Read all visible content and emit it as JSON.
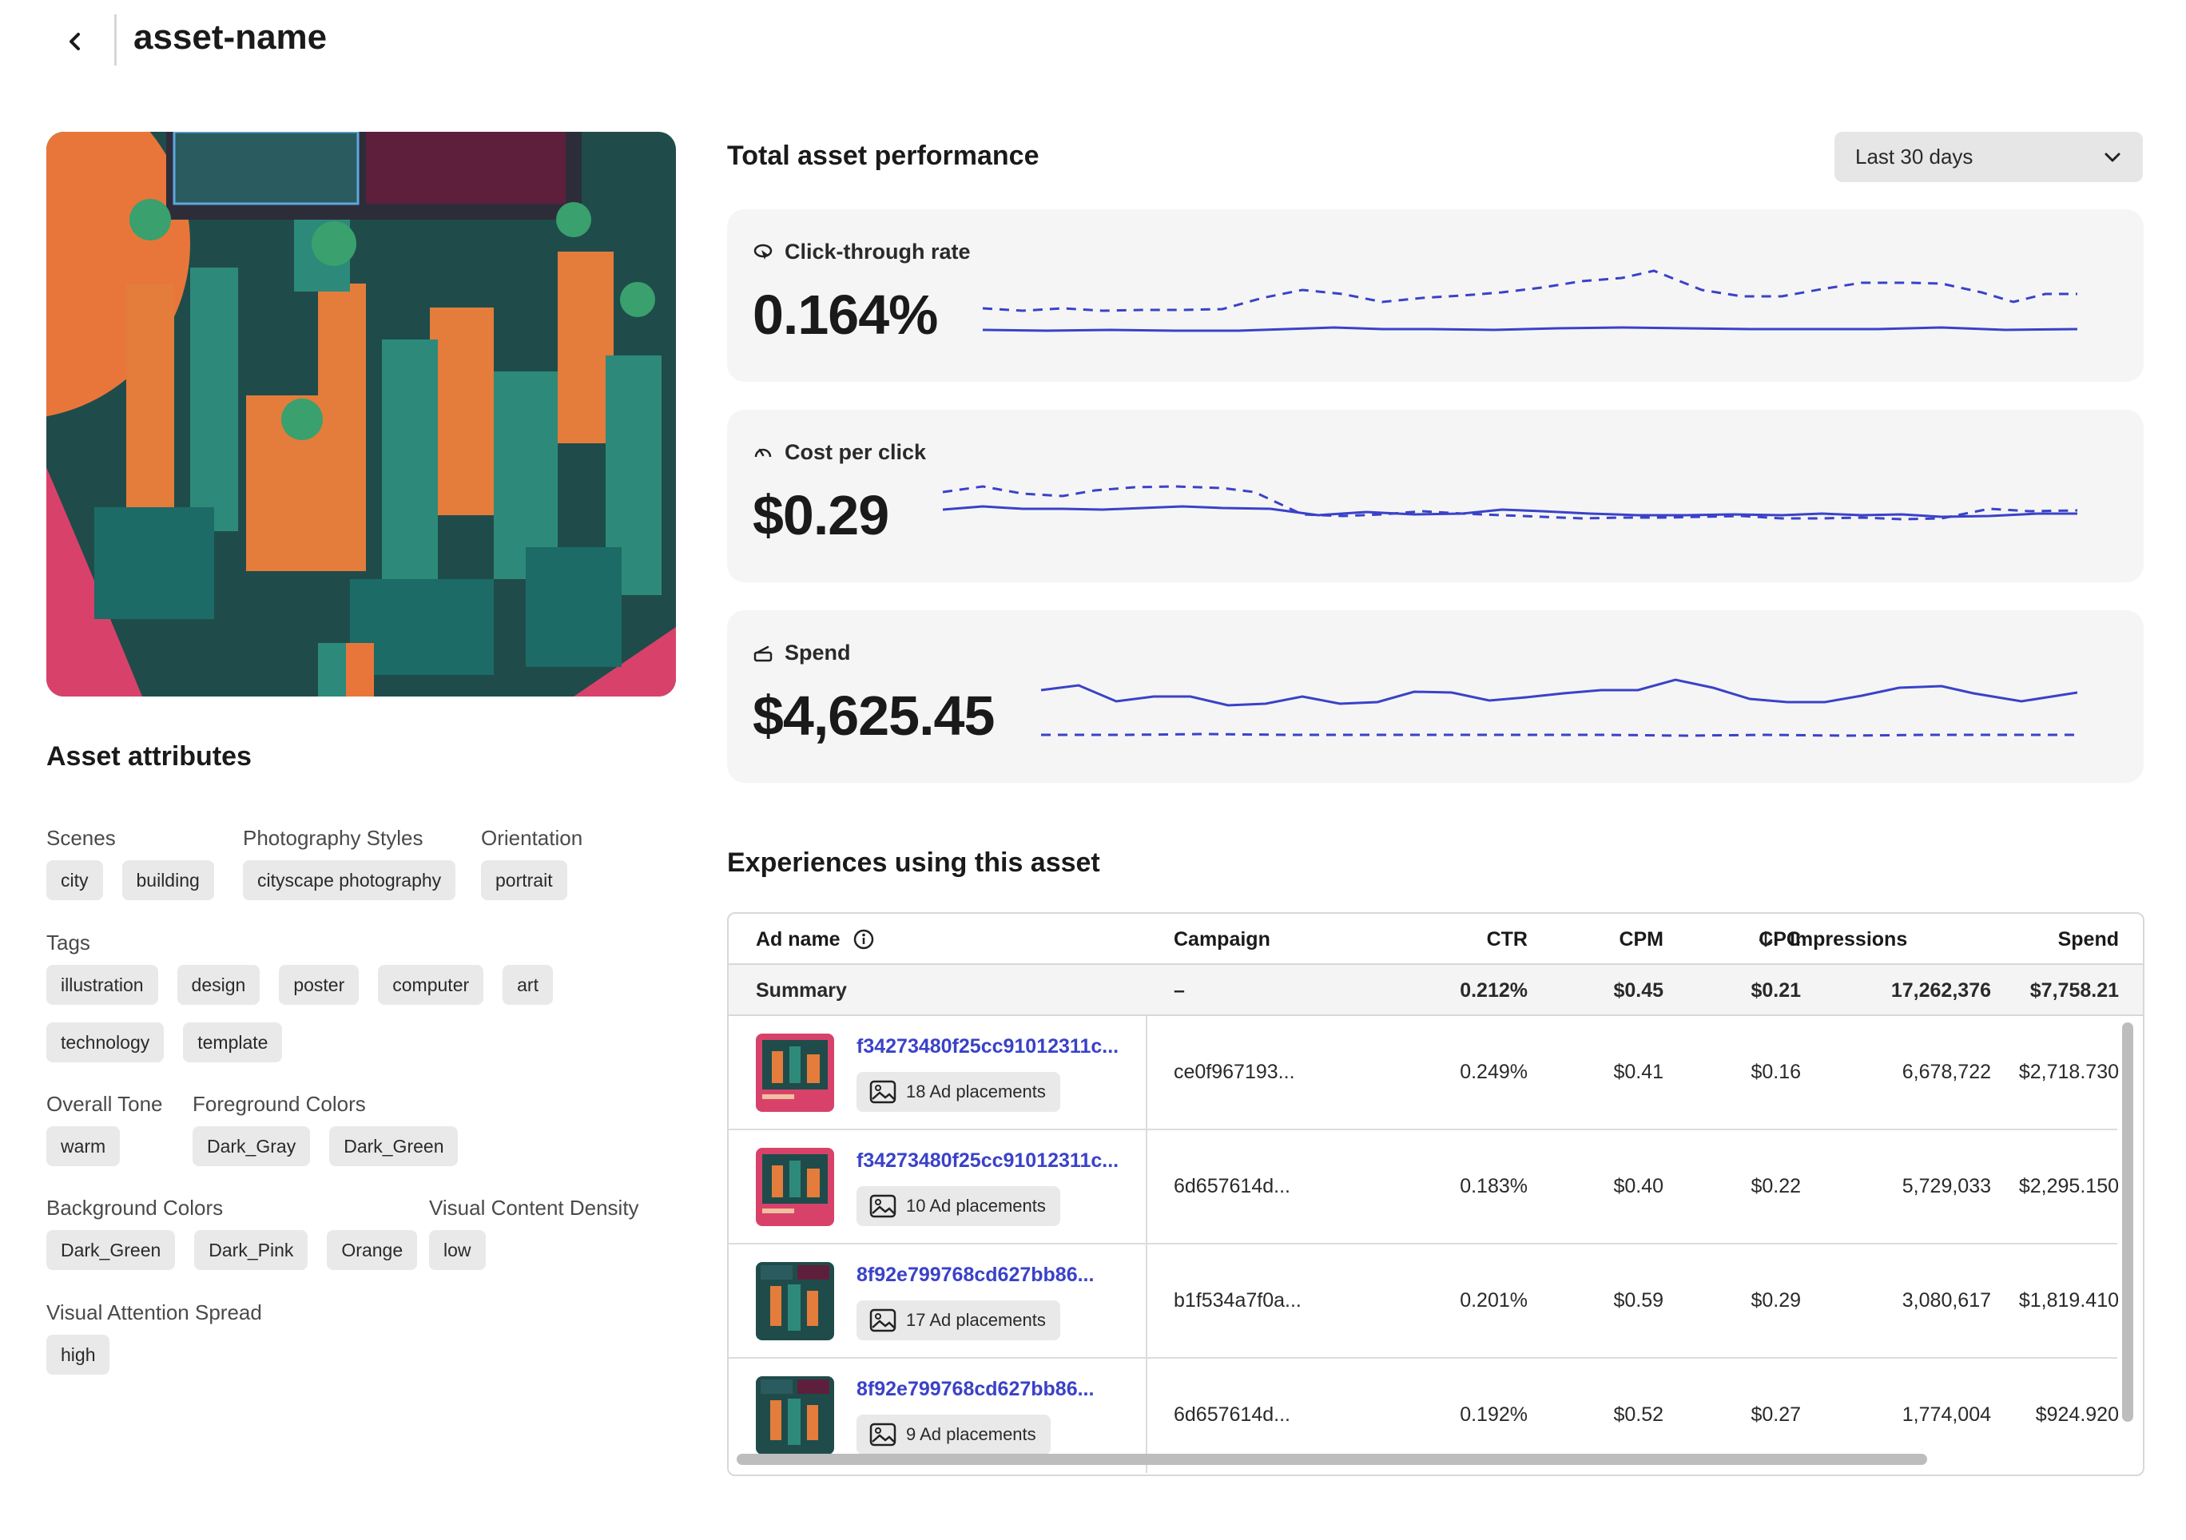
{
  "header": {
    "title": "asset-name"
  },
  "attributes": {
    "title": "Asset attributes",
    "scenes": {
      "label": "Scenes",
      "tags": [
        "city",
        "building"
      ]
    },
    "photography_styles": {
      "label": "Photography Styles",
      "tags": [
        "cityscape photography"
      ]
    },
    "orientation": {
      "label": "Orientation",
      "tags": [
        "portrait"
      ]
    },
    "tags": {
      "label": "Tags",
      "tags": [
        "illustration",
        "design",
        "poster",
        "computer",
        "art",
        "technology",
        "template"
      ]
    },
    "overall_tone": {
      "label": "Overall Tone",
      "tags": [
        "warm"
      ]
    },
    "foreground_colors": {
      "label": "Foreground Colors",
      "tags": [
        "Dark_Gray",
        "Dark_Green"
      ]
    },
    "background_colors": {
      "label": "Background Colors",
      "tags": [
        "Dark_Green",
        "Dark_Pink",
        "Orange"
      ]
    },
    "visual_content_density": {
      "label": "Visual Content Density",
      "tags": [
        "low"
      ]
    },
    "visual_attention_spread": {
      "label": "Visual Attention Spread",
      "tags": [
        "high"
      ]
    }
  },
  "performance": {
    "title": "Total asset performance",
    "range": "Last 30 days",
    "metrics": [
      {
        "label": "Click-through rate",
        "icon": "cursor-click-icon",
        "value": "0.164%"
      },
      {
        "label": "Cost per click",
        "icon": "speedometer-icon",
        "value": "$0.29"
      },
      {
        "label": "Spend",
        "icon": "wallet-icon",
        "value": "$4,625.45"
      }
    ]
  },
  "experiences": {
    "title": "Experiences using this asset",
    "columns": {
      "ad_name": "Ad name",
      "campaign": "Campaign",
      "ctr": "CTR",
      "cpm": "CPM",
      "cpc": "CPC",
      "impressions": "Impressions",
      "spend": "Spend"
    },
    "sorted_column": "Impressions",
    "summary": {
      "label": "Summary",
      "campaign": "–",
      "ctr": "0.212%",
      "cpm": "$0.45",
      "cpc": "$0.21",
      "impressions": "17,262,376",
      "spend": "$7,758.21"
    },
    "rows": [
      {
        "ad_name": "f34273480f25cc91012311c...",
        "placements": "18 Ad placements",
        "campaign": "ce0f967193...",
        "ctr": "0.249%",
        "cpm": "$0.41",
        "cpc": "$0.16",
        "impressions": "6,678,722",
        "spend": "$2,718.730"
      },
      {
        "ad_name": "f34273480f25cc91012311c...",
        "placements": "10 Ad placements",
        "campaign": "6d657614d...",
        "ctr": "0.183%",
        "cpm": "$0.40",
        "cpc": "$0.22",
        "impressions": "5,729,033",
        "spend": "$2,295.150"
      },
      {
        "ad_name": "8f92e799768cd627bb86...",
        "placements": "17 Ad placements",
        "campaign": "b1f534a7f0a...",
        "ctr": "0.201%",
        "cpm": "$0.59",
        "cpc": "$0.29",
        "impressions": "3,080,617",
        "spend": "$1,819.410"
      },
      {
        "ad_name": "8f92e799768cd627bb86...",
        "placements": "9 Ad placements",
        "campaign": "6d657614d...",
        "ctr": "0.192%",
        "cpm": "$0.52",
        "cpc": "$0.27",
        "impressions": "1,774,004",
        "spend": "$924.920"
      }
    ]
  },
  "colors": {
    "accent": "#3a42c8",
    "card_bg": "#f5f5f5",
    "tag_bg": "#e9e9e9"
  }
}
